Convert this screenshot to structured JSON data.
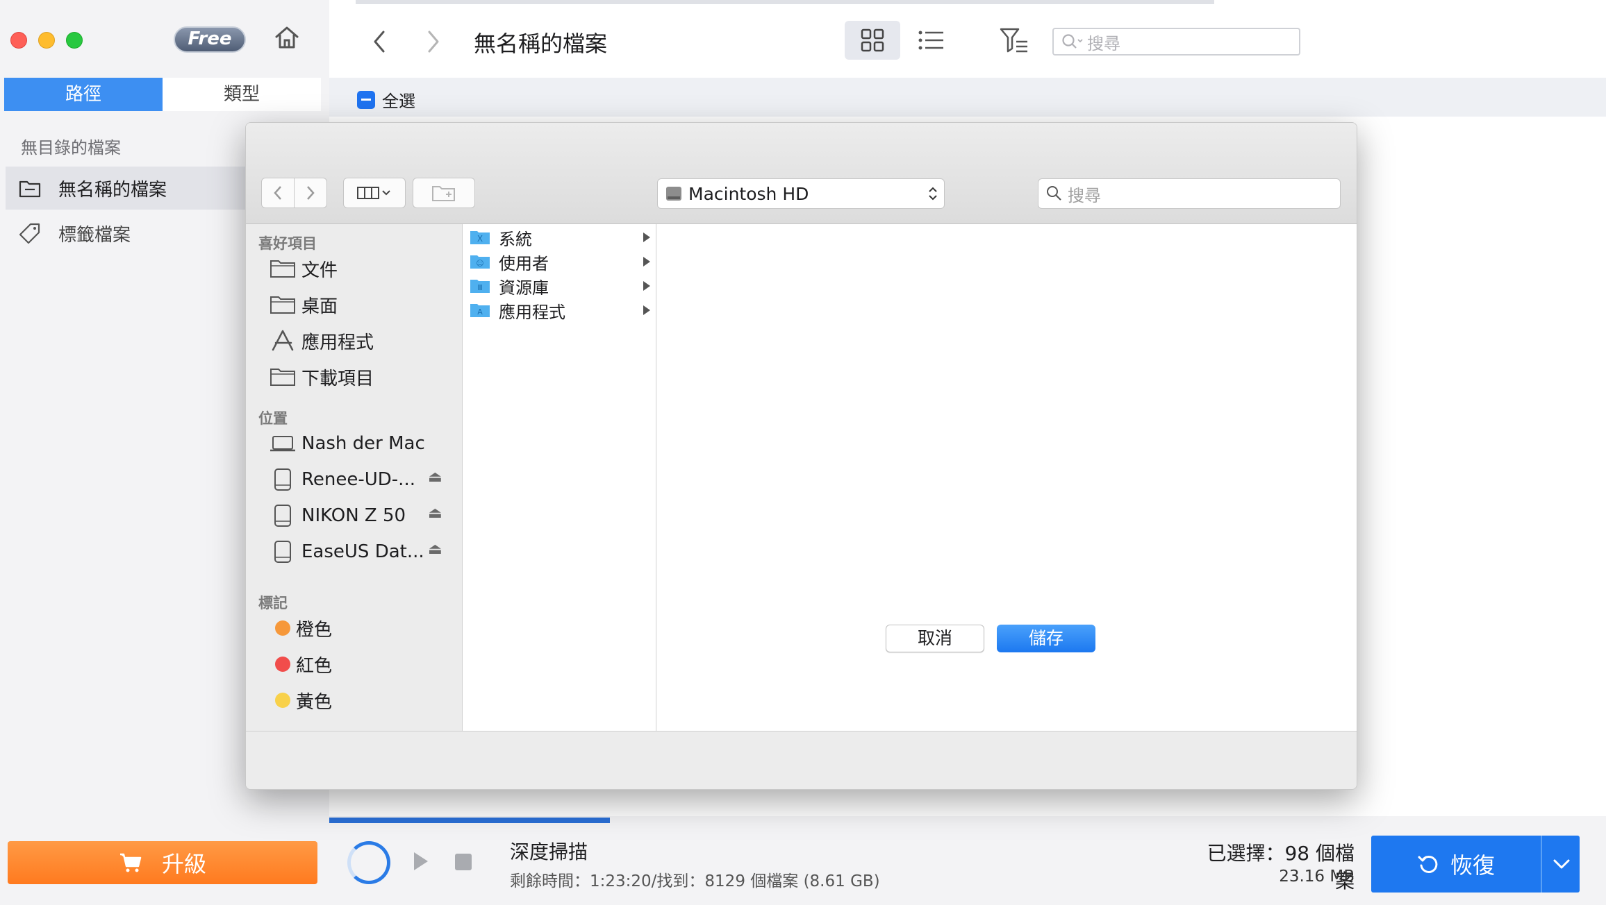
{
  "app": {
    "free_badge": "Free",
    "tabs": [
      "路徑",
      "類型"
    ]
  },
  "sidebar": {
    "heading": "無目錄的檔案",
    "items": [
      {
        "label": "無名稱的檔案",
        "icon": "folder-icon",
        "active": true
      },
      {
        "label": "標籤檔案",
        "icon": "tag-icon",
        "active": false
      }
    ],
    "upgrade_label": "升級"
  },
  "main": {
    "title": "無名稱的檔案",
    "search_placeholder": "搜尋",
    "select_all_label": "全選"
  },
  "dialog": {
    "location": "Macintosh HD",
    "search_placeholder": "搜尋",
    "favorites_heading": "喜好項目",
    "favorites": [
      {
        "label": "文件",
        "icon": "folder-icon"
      },
      {
        "label": "桌面",
        "icon": "folder-icon"
      },
      {
        "label": "應用程式",
        "icon": "apps-icon"
      },
      {
        "label": "下載項目",
        "icon": "folder-icon"
      }
    ],
    "locations_heading": "位置",
    "locations": [
      {
        "label": "Nash der Mac",
        "icon": "laptop-icon",
        "ejectable": false
      },
      {
        "label": "Renee-UD-...",
        "icon": "drive-icon",
        "ejectable": true
      },
      {
        "label": "NIKON Z 50",
        "icon": "drive-icon",
        "ejectable": true
      },
      {
        "label": "EaseUS Dat...",
        "icon": "drive-icon",
        "ejectable": true
      }
    ],
    "tags_heading": "標記",
    "tags": [
      {
        "label": "橙色",
        "color": "#f6983a"
      },
      {
        "label": "紅色",
        "color": "#f14d4b"
      },
      {
        "label": "黃色",
        "color": "#f8d14a"
      }
    ],
    "column_items": [
      {
        "label": "系統",
        "glyph": "X"
      },
      {
        "label": "使用者",
        "glyph": "☺"
      },
      {
        "label": "資源庫",
        "glyph": "Ⅲ"
      },
      {
        "label": "應用程式",
        "glyph": "A"
      }
    ],
    "cancel_label": "取消",
    "save_label": "儲存"
  },
  "status": {
    "scan_title": "深度掃描",
    "scan_detail": "剩餘時間：1:23:20/找到：8129 個檔案 (8.61 GB)",
    "selected_count": "已選擇：98 個檔案",
    "selected_size": "23.16 MB",
    "recover_label": "恢復",
    "progress_fraction": 0.22
  },
  "colors": {
    "accent": "#1e78f0",
    "upgrade": "#ff8a2c"
  }
}
